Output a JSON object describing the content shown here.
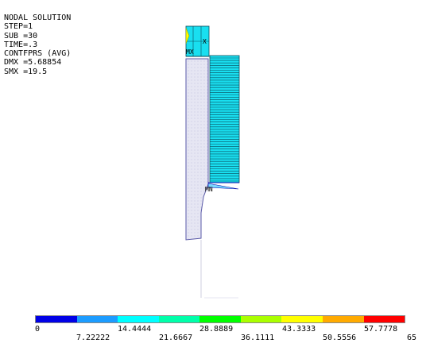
{
  "info": {
    "lines": [
      "NODAL SOLUTION",
      "STEP=1",
      "SUB =30",
      "TIME=.3",
      "CONTFPRS (AVG)",
      "DMX =5.68854",
      "SMX =19.5"
    ]
  },
  "labels": {
    "mx": "MX",
    "mn": "MN",
    "x": "X"
  },
  "legend": {
    "colors": [
      "#0000e6",
      "#1c9cff",
      "#00ffff",
      "#00ffaa",
      "#00ff00",
      "#aaff00",
      "#ffff00",
      "#ffaa00",
      "#ff0000"
    ],
    "ticks_top": [
      "0",
      "14.4444",
      "28.8889",
      "43.3333",
      "57.7778"
    ],
    "ticks_bottom": [
      "7.22222",
      "21.6667",
      "36.1111",
      "50.5556",
      "65"
    ]
  }
}
